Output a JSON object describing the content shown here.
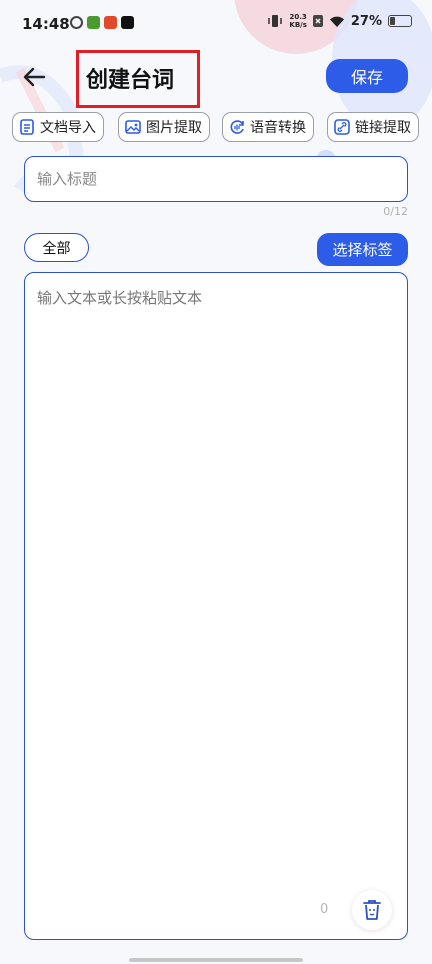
{
  "status_bar": {
    "time": "14:48",
    "net_speed_value": "20.3",
    "net_speed_unit": "KB/s",
    "battery_text": "27%",
    "battery_level_percent": 27
  },
  "header": {
    "title": "创建台词",
    "save_label": "保存"
  },
  "toolbar": {
    "items": [
      {
        "label": "文档导入",
        "icon": "document-icon"
      },
      {
        "label": "图片提取",
        "icon": "image-icon"
      },
      {
        "label": "语音转换",
        "icon": "voice-convert-icon"
      },
      {
        "label": "链接提取",
        "icon": "link-icon"
      }
    ]
  },
  "title_input": {
    "placeholder": "输入标题",
    "value": "",
    "counter": "0/12"
  },
  "tags": {
    "current": "全部",
    "select_label": "选择标签"
  },
  "content": {
    "placeholder": "输入文本或长按粘贴文本",
    "value": "",
    "counter": "0"
  },
  "colors": {
    "accent": "#2c5ce8",
    "border": "#2c52c8",
    "highlight": "#e01e23"
  }
}
